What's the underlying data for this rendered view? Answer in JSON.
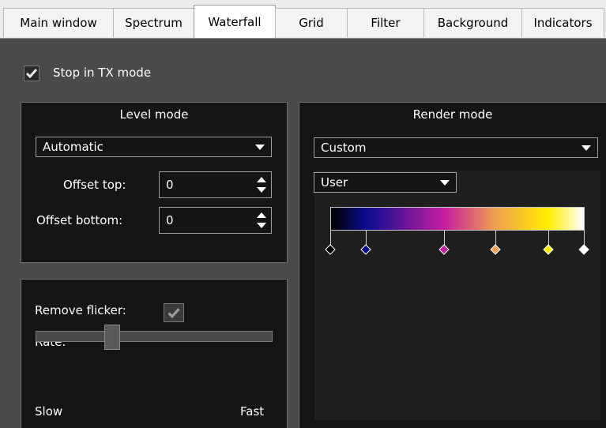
{
  "tabs": [
    {
      "label": "Main window"
    },
    {
      "label": "Spectrum"
    },
    {
      "label": "Waterfall"
    },
    {
      "label": "Grid"
    },
    {
      "label": "Filter"
    },
    {
      "label": "Background"
    },
    {
      "label": "Indicators"
    }
  ],
  "active_tab": "Waterfall",
  "stop_in_tx": {
    "label": "Stop in TX mode",
    "checked": true
  },
  "level_mode": {
    "title": "Level mode",
    "mode": "Automatic",
    "offset_top_label": "Offset top:",
    "offset_top_value": "0",
    "offset_bottom_label": "Offset bottom:",
    "offset_bottom_value": "0"
  },
  "flicker": {
    "remove_label": "Remove flicker:",
    "remove_checked": true,
    "rate_label": "Rate:",
    "rate_value": 0.31,
    "slow_label": "Slow",
    "fast_label": "Fast"
  },
  "render_mode": {
    "title": "Render mode",
    "mode": "Custom",
    "palette": "User",
    "colors": [
      "#000000",
      "#0c0c90",
      "#c81ea0",
      "#f0a050",
      "#ffee00",
      "#ffffff"
    ],
    "stops": [
      {
        "fraction": 0.0,
        "color": "#000000"
      },
      {
        "fraction": 0.14,
        "color": "#0c0c90"
      },
      {
        "fraction": 0.45,
        "color": "#c81ea0"
      },
      {
        "fraction": 0.65,
        "color": "#f0a050"
      },
      {
        "fraction": 0.86,
        "color": "#ffee00"
      },
      {
        "fraction": 1.0,
        "color": "#ffffff"
      }
    ]
  }
}
